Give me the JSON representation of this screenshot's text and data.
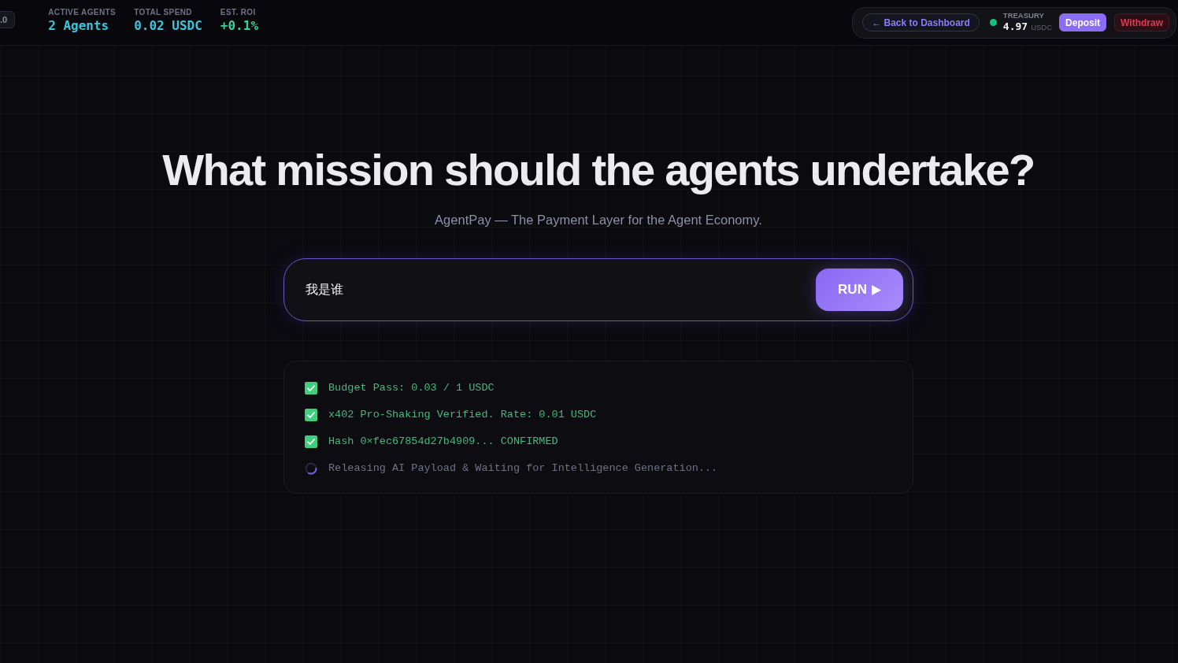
{
  "header": {
    "version_badge": ".0",
    "stats": [
      {
        "label": "ACTIVE AGENTS",
        "value": "2 Agents",
        "color": "#3cc4dc"
      },
      {
        "label": "TOTAL SPEND",
        "value": "0.02 USDC",
        "color": "#3cc4dc"
      },
      {
        "label": "EST. ROI",
        "value": "+0.1%",
        "color": "#34d399"
      }
    ],
    "back_link": "← Back to Dashboard",
    "treasury": {
      "connected": true,
      "label": "TREASURY",
      "amount": "4.97",
      "unit": "USDC"
    },
    "buttons": [
      {
        "kind": "primary",
        "label": "Deposit"
      },
      {
        "kind": "danger",
        "label": "Withdraw"
      }
    ]
  },
  "hero": {
    "title": "What mission should the agents undertake?",
    "subtitle": "AgentPay — The Payment Layer for the Agent Economy."
  },
  "prompt": {
    "value": "我是谁",
    "button": "RUN"
  },
  "log": [
    {
      "kind": "done",
      "text": "Budget Pass: 0.03 / 1 USDC"
    },
    {
      "kind": "done",
      "text": "x402 Pro-Shaking Verified. Rate: 0.01 USDC"
    },
    {
      "kind": "done",
      "text": "Hash 0×fec67854d27b4909... CONFIRMED"
    },
    {
      "kind": "pending",
      "text": "Releasing AI Payload & Waiting for Intelligence Generation..."
    }
  ]
}
